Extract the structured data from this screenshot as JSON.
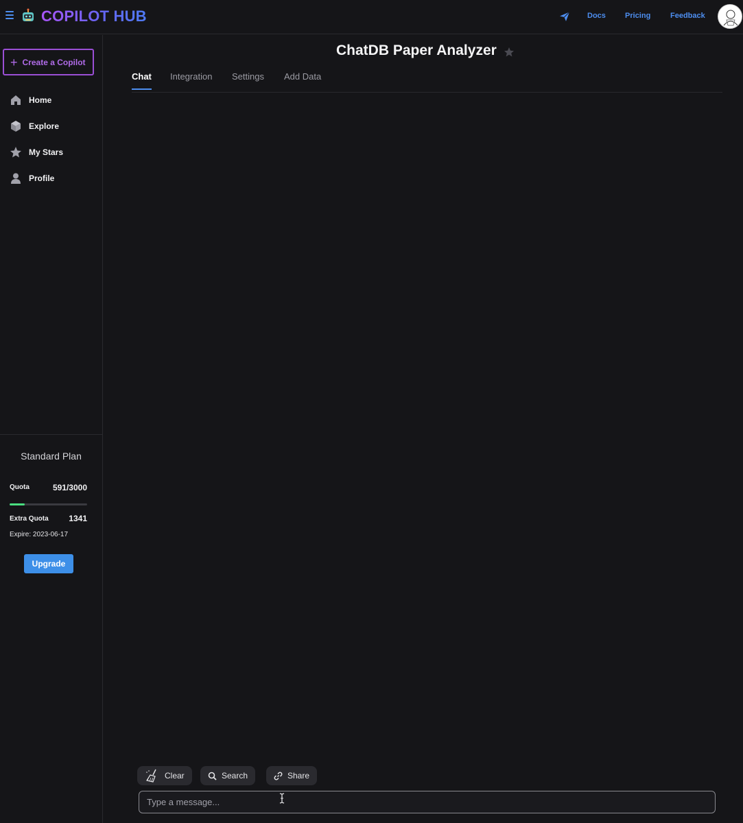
{
  "header": {
    "brand": "COPILOT HUB",
    "links": [
      "Docs",
      "Pricing",
      "Feedback"
    ],
    "icons": [
      "menu-icon",
      "robot-logo-icon",
      "send-icon",
      "avatar"
    ]
  },
  "sidebar": {
    "create_label": "Create a Copilot",
    "items": [
      {
        "label": "Home",
        "icon": "home-icon"
      },
      {
        "label": "Explore",
        "icon": "cube-icon"
      },
      {
        "label": "My Stars",
        "icon": "star-icon"
      },
      {
        "label": "Profile",
        "icon": "user-icon"
      }
    ],
    "plan": {
      "title": "Standard Plan",
      "quota_label": "Quota",
      "quota_value": "591/3000",
      "quota_fraction": 0.197,
      "extra_label": "Extra Quota",
      "extra_value": "1341",
      "expire": "Expire: 2023-06-17",
      "upgrade_label": "Upgrade"
    }
  },
  "main": {
    "title": "ChatDB Paper Analyzer",
    "tabs": [
      {
        "label": "Chat",
        "active": true
      },
      {
        "label": "Integration",
        "active": false
      },
      {
        "label": "Settings",
        "active": false
      },
      {
        "label": "Add Data",
        "active": false
      }
    ],
    "actions": {
      "clear_label": "Clear",
      "search_label": "Search",
      "share_label": "Share"
    },
    "input": {
      "placeholder": "Type a message...",
      "value": ""
    }
  },
  "colors": {
    "background": "#151518",
    "accent_blue": "#4d8ef0",
    "accent_purple": "#9b4fd6",
    "quota_green": "#4ade80"
  }
}
